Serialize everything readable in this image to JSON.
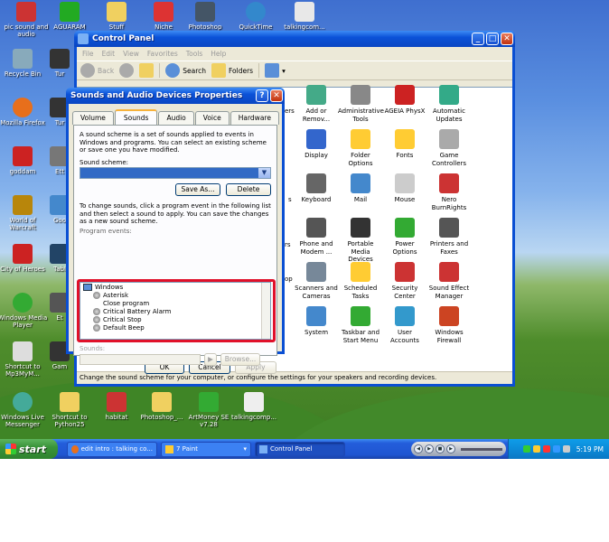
{
  "desktop": {
    "icons": [
      {
        "label": "pic sound and audio"
      },
      {
        "label": "AGUARAM"
      },
      {
        "label": "Stuff"
      },
      {
        "label": "Niche"
      },
      {
        "label": "Photoshop"
      },
      {
        "label": "QuickTime"
      },
      {
        "label": "talkingcom..."
      },
      {
        "label": "Recycle Bin"
      },
      {
        "label": "Tur"
      },
      {
        "label": "Mozilla Firefox"
      },
      {
        "label": "Tur"
      },
      {
        "label": "goddam"
      },
      {
        "label": "Ett"
      },
      {
        "label": "World of Warcraft"
      },
      {
        "label": "Goo"
      },
      {
        "label": "City of Heroes"
      },
      {
        "label": "Tabl"
      },
      {
        "label": "Windows Media Player"
      },
      {
        "label": "Et"
      },
      {
        "label": "Shortcut to Mp3MyM..."
      },
      {
        "label": "Gam"
      },
      {
        "label": "Windows Live Messenger"
      },
      {
        "label": "Shortcut to Python25"
      },
      {
        "label": "habitat"
      },
      {
        "label": "Photoshop_..."
      },
      {
        "label": "ArtMoney SE v7.28"
      },
      {
        "label": "talkingcomp..."
      }
    ]
  },
  "control_panel": {
    "title": "Control Panel",
    "menu": [
      "File",
      "Edit",
      "View",
      "Favorites",
      "Tools",
      "Help"
    ],
    "toolbar": {
      "back": "Back",
      "search": "Search",
      "folders": "Folders"
    },
    "items": [
      {
        "label": "Add or Remov..."
      },
      {
        "label": "Administrative Tools"
      },
      {
        "label": "AGEIA PhysX"
      },
      {
        "label": "Automatic Updates"
      },
      {
        "label": "Display"
      },
      {
        "label": "Folder Options"
      },
      {
        "label": "Fonts"
      },
      {
        "label": "Game Controllers"
      },
      {
        "label": "Keyboard"
      },
      {
        "label": "Mail"
      },
      {
        "label": "Mouse"
      },
      {
        "label": "Nero BurnRights"
      },
      {
        "label": "Phone and Modem ..."
      },
      {
        "label": "Portable Media Devices"
      },
      {
        "label": "Power Options"
      },
      {
        "label": "Printers and Faxes"
      },
      {
        "label": "Scanners and Cameras"
      },
      {
        "label": "Scheduled Tasks"
      },
      {
        "label": "Security Center"
      },
      {
        "label": "Sound Effect Manager"
      },
      {
        "label": "System"
      },
      {
        "label": "Taskbar and Start Menu"
      },
      {
        "label": "User Accounts"
      },
      {
        "label": "Windows Firewall"
      }
    ],
    "partial_labels": [
      "ers",
      "s",
      "rs",
      "op"
    ],
    "status": "Change the sound scheme for your computer, or configure the settings for your speakers and recording devices."
  },
  "dialog": {
    "title": "Sounds and Audio Devices Properties",
    "tabs": [
      "Volume",
      "Sounds",
      "Audio",
      "Voice",
      "Hardware"
    ],
    "active_tab": "Sounds",
    "intro": "A sound scheme is a set of sounds applied to events in Windows and programs. You can select an existing scheme or save one you have modified.",
    "scheme_label": "Sound scheme:",
    "save_as": "Save As...",
    "delete": "Delete",
    "events_intro": "To change sounds, click a program event in the following list and then select a sound to apply. You can save the changes as a new sound scheme.",
    "events_label": "Program events:",
    "events": [
      {
        "label": "Windows",
        "root": true
      },
      {
        "label": "Asterisk"
      },
      {
        "label": "Close program",
        "no_icon": true
      },
      {
        "label": "Critical Battery Alarm"
      },
      {
        "label": "Critical Stop"
      },
      {
        "label": "Default Beep"
      }
    ],
    "sounds_label": "Sounds:",
    "browse": "Browse...",
    "ok": "OK",
    "cancel": "Cancel",
    "apply": "Apply"
  },
  "taskbar": {
    "start": "start",
    "tasks": [
      {
        "label": "edit intro : talking co..."
      },
      {
        "label": "7 Paint"
      },
      {
        "label": "Control Panel"
      }
    ],
    "clock": "5:19 PM"
  },
  "colors": {
    "highlight": "#e0102a",
    "xp_blue": "#0a4fd3"
  }
}
